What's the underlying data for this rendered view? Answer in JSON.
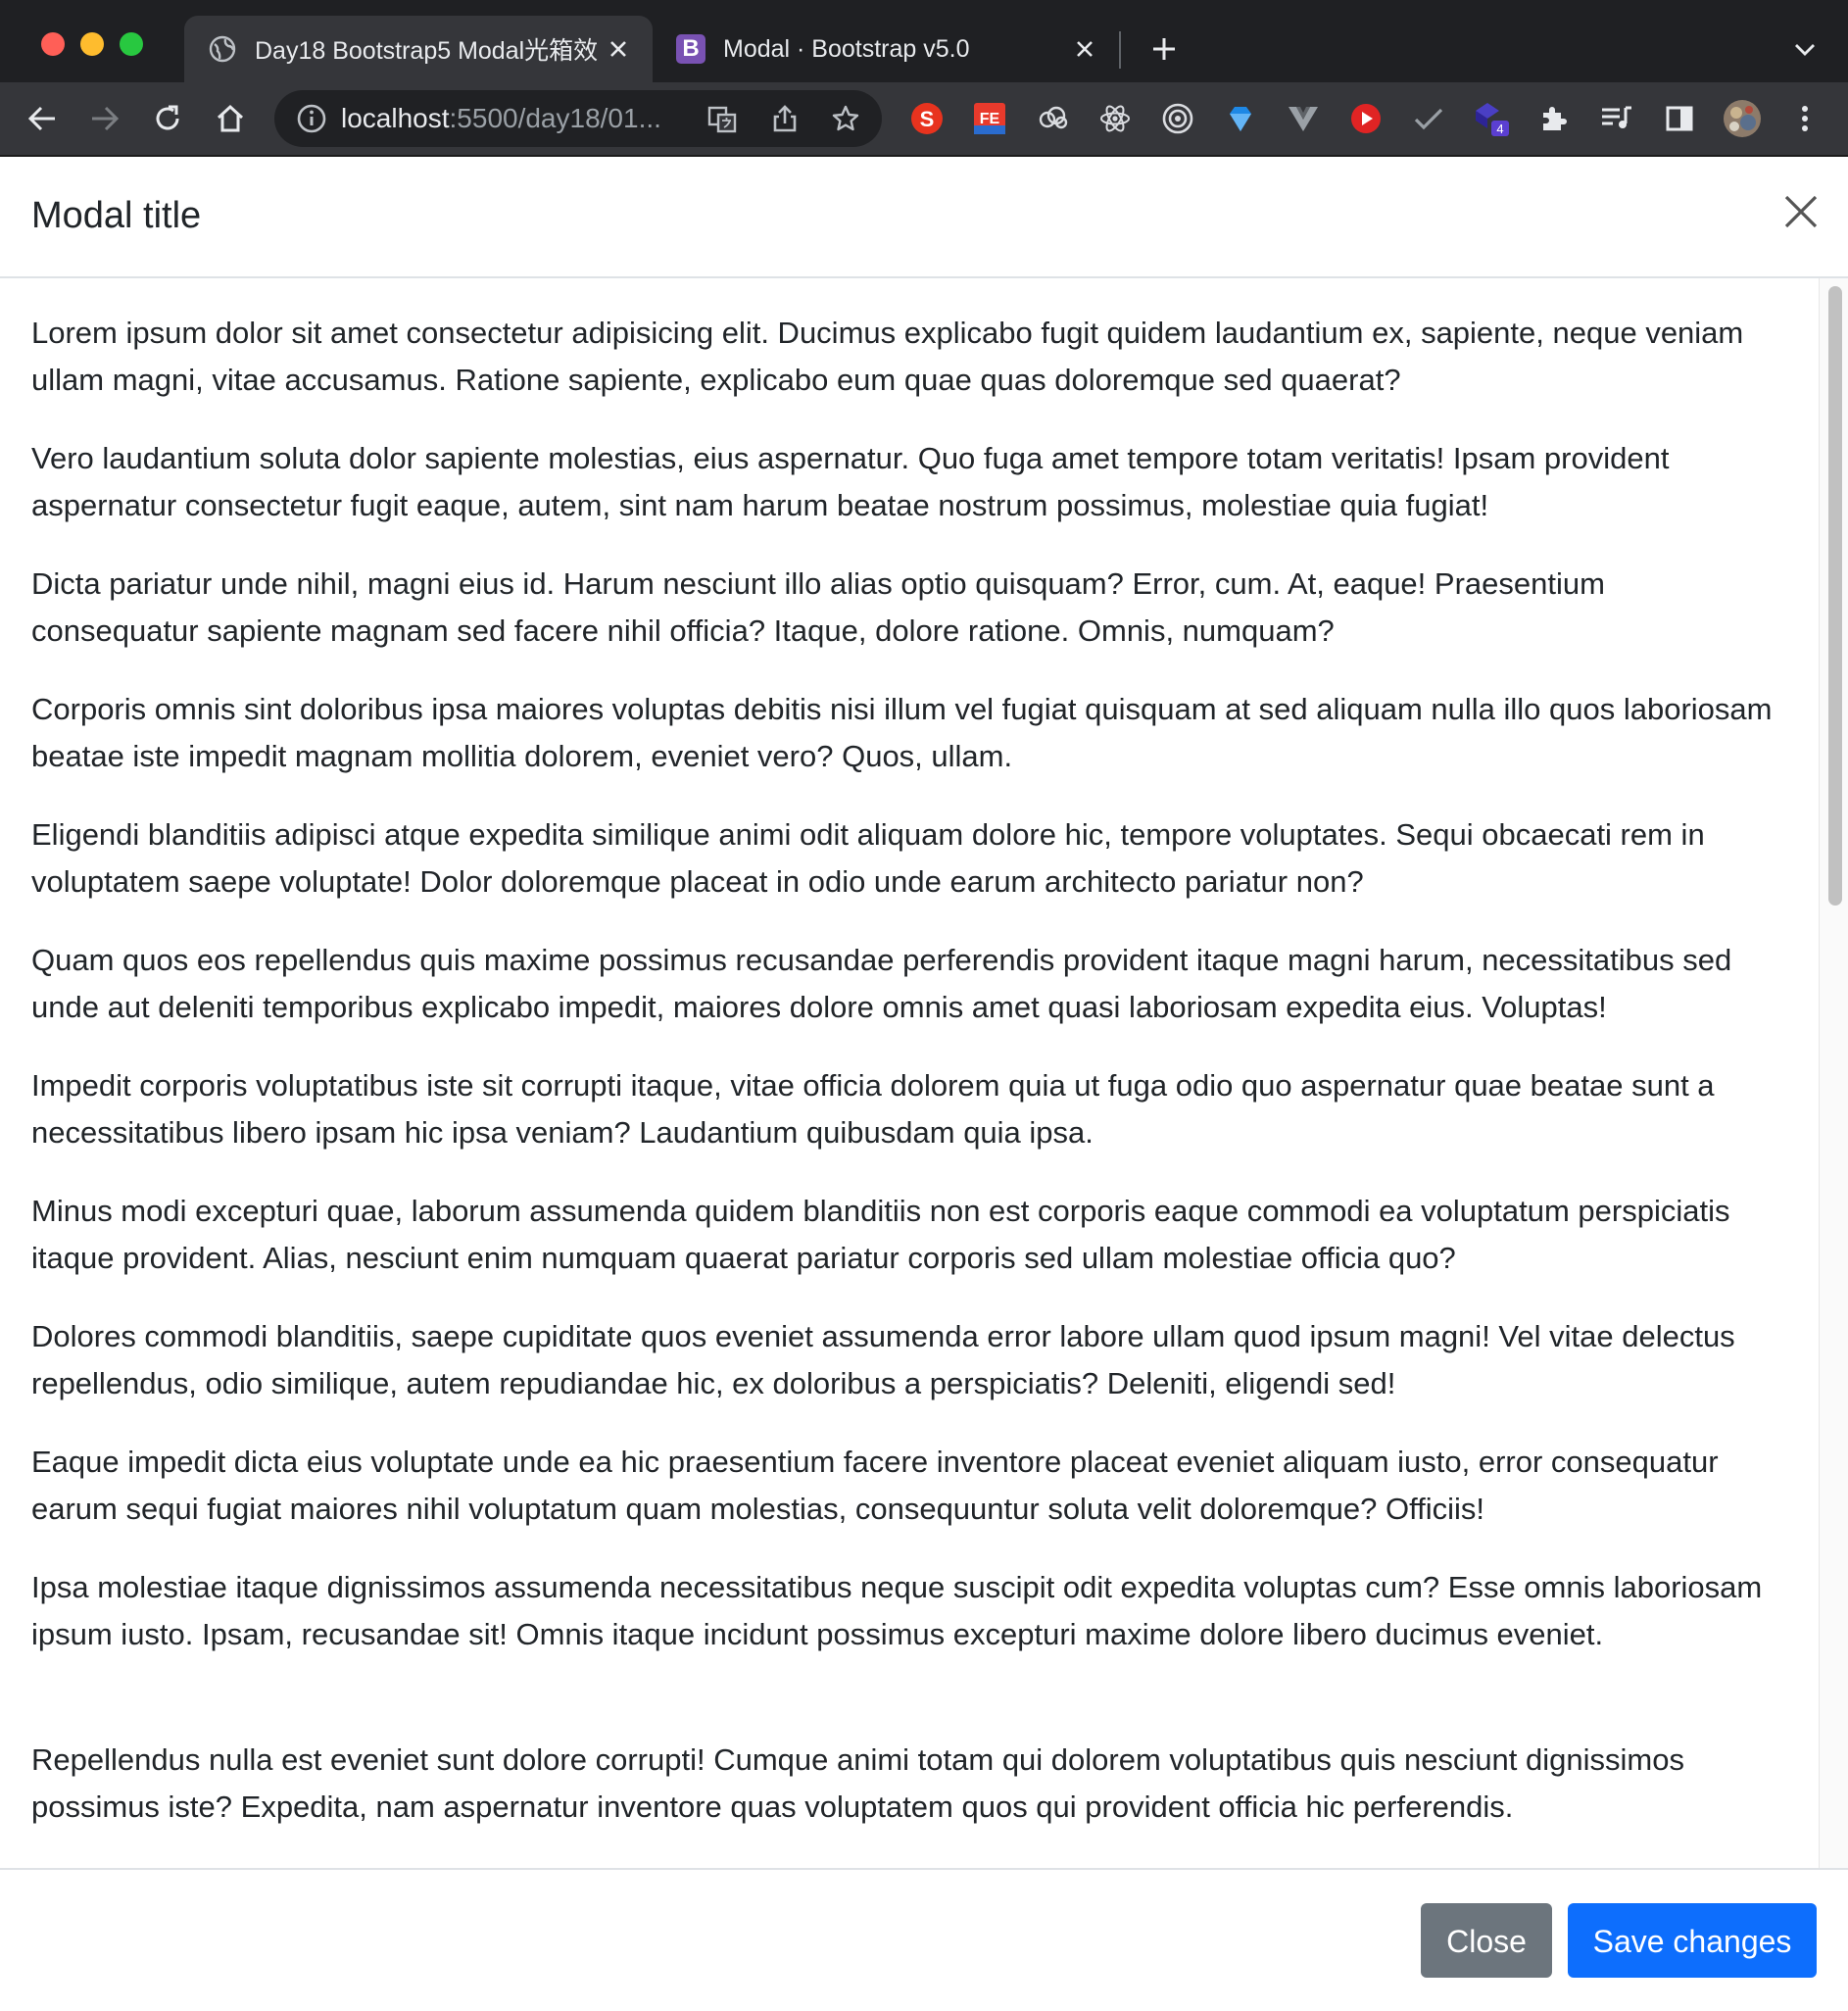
{
  "browser": {
    "tabs": [
      {
        "title": "Day18 Bootstrap5 Modal光箱效",
        "favicon": "globe-icon",
        "active": true
      },
      {
        "title": "Modal · Bootstrap v5.0",
        "favicon": "bootstrap-icon",
        "favicon_letter": "B",
        "active": false
      }
    ],
    "address": {
      "host": "localhost",
      "rest": ":5500/day18/01..."
    },
    "extension_badge": "4",
    "colors": {
      "close": "#ff5f57",
      "minimize": "#febc2e",
      "zoom": "#28c840",
      "bootstrap": "#7952b3"
    }
  },
  "modal": {
    "title": "Modal title",
    "paragraphs": [
      "Lorem ipsum dolor sit amet consectetur adipisicing elit. Ducimus explicabo fugit quidem laudantium ex, sapiente, neque veniam ullam magni, vitae accusamus. Ratione sapiente, explicabo eum quae quas doloremque sed quaerat?",
      "Vero laudantium soluta dolor sapiente molestias, eius aspernatur. Quo fuga amet tempore totam veritatis! Ipsam provident aspernatur consectetur fugit eaque, autem, sint nam harum beatae nostrum possimus, molestiae quia fugiat!",
      "Dicta pariatur unde nihil, magni eius id. Harum nesciunt illo alias optio quisquam? Error, cum. At, eaque! Praesentium consequatur sapiente magnam sed facere nihil officia? Itaque, dolore ratione. Omnis, numquam?",
      "Corporis omnis sint doloribus ipsa maiores voluptas debitis nisi illum vel fugiat quisquam at sed aliquam nulla illo quos laboriosam beatae iste impedit magnam mollitia dolorem, eveniet vero? Quos, ullam.",
      "Eligendi blanditiis adipisci atque expedita similique animi odit aliquam dolore hic, tempore voluptates. Sequi obcaecati rem in voluptatem saepe voluptate! Dolor doloremque placeat in odio unde earum architecto pariatur non?",
      "Quam quos eos repellendus quis maxime possimus recusandae perferendis provident itaque magni harum, necessitatibus sed unde aut deleniti temporibus explicabo impedit, maiores dolore omnis amet quasi laboriosam expedita eius. Voluptas!",
      "Impedit corporis voluptatibus iste sit corrupti itaque, vitae officia dolorem quia ut fuga odio quo aspernatur quae beatae sunt a necessitatibus libero ipsam hic ipsa veniam? Laudantium quibusdam quia ipsa.",
      "Minus modi excepturi quae, laborum assumenda quidem blanditiis non est corporis eaque commodi ea voluptatum perspiciatis itaque provident. Alias, nesciunt enim numquam quaerat pariatur corporis sed ullam molestiae officia quo?",
      "Dolores commodi blanditiis, saepe cupiditate quos eveniet assumenda error labore ullam quod ipsum magni! Vel vitae delectus repellendus, odio similique, autem repudiandae hic, ex doloribus a perspiciatis? Deleniti, eligendi sed!",
      "Eaque impedit dicta eius voluptate unde ea hic praesentium facere inventore placeat eveniet aliquam iusto, error consequatur earum sequi fugiat maiores nihil voluptatum quam molestias, consequuntur soluta velit doloremque? Officiis!",
      "Ipsa molestiae itaque dignissimos assumenda necessitatibus neque suscipit odit expedita voluptas cum? Esse omnis laboriosam ipsum iusto. Ipsam, recusandae sit! Omnis itaque incidunt possimus excepturi maxime dolore libero ducimus eveniet.",
      "Repellendus nulla est eveniet sunt dolore corrupti! Cumque animi totam qui dolorem voluptatibus quis nesciunt dignissimos possimus iste? Expedita, nam aspernatur inventore quas voluptatem quos qui provident officia hic perferendis."
    ],
    "buttons": {
      "close": "Close",
      "save": "Save changes"
    },
    "colors": {
      "primary": "#0d6efd",
      "secondary": "#6c757d"
    }
  }
}
